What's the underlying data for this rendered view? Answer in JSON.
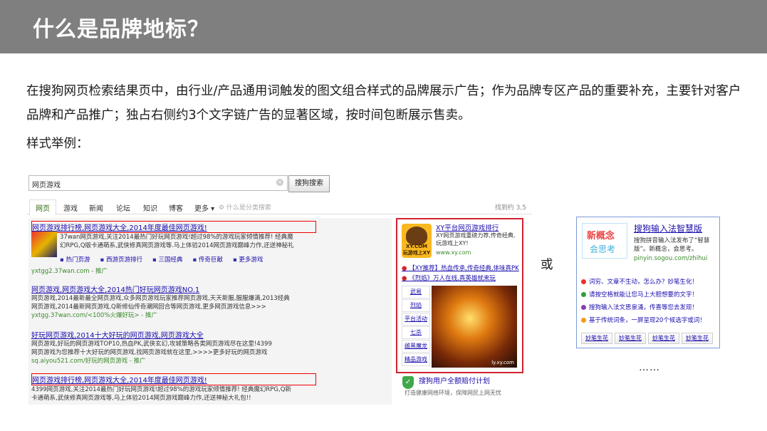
{
  "slide": {
    "title": "什么是品牌地标？",
    "description": "在搜狗网页检索结果页中，由行业/产品通用词触发的图文组合样式的品牌展示广告；作为品牌专区产品的重要补充，主要针对客户品牌和产品推广；独占右侧约3个文字链广告的显著区域，按时间包断展示售卖。",
    "example_label": "样式举例：",
    "or_label": "或",
    "ellipsis": "……"
  },
  "serp": {
    "query": "网页游戏",
    "search_button": "搜狗搜索",
    "clear_icon": "×",
    "tabs": [
      "网页",
      "游戏",
      "新闻",
      "论坛",
      "知识",
      "博客",
      "更多 ▾"
    ],
    "hint": "⚙ 什么是分类搜索",
    "result_count": "找到约 3,5",
    "results": [
      {
        "title": "网页游戏排行榜,网页游戏大全,2014年度最佳网页游戏!",
        "desc1": "37wan网页游戏,关注2014最热门好玩网页游戏!超过98%的游戏玩家倾情推荐! 经典魔",
        "desc2": "幻RPG,Q版卡通萌系,武侠修真网页游戏等.马上体验2014网页游戏巅峰力作,还送神秘礼",
        "sublinks": [
          "热门页游",
          "西游页游排行",
          "三国经典",
          "传奇巨献",
          "更多游戏"
        ],
        "url": "yxtgg2.37wan.com - 推广"
      },
      {
        "title": "网页游戏,网页游戏大全,2014热门好玩网页游戏NO.1",
        "desc1": "网页游戏,2014最新最全网页游戏,众多网页游戏玩家推荐网页游戏,天天新服,服服爆满,2013经典",
        "desc2": "网页游戏,2014最新网页游戏,Q新修仙传奇潮网回合等网页游戏,更多网页游戏信息>>>",
        "url": "yxtgg.37wan.com/<100%火爆好玩> - 推广"
      },
      {
        "title": "好玩网页游戏,2014十大好玩的网页游戏,网页游戏大全",
        "desc1": "网页游戏,好玩的网页游戏TOP10,热血PK,武侠玄幻,攻城策略各类网页游戏尽在这里!4399",
        "desc2": "网页游戏为您推荐十大好玩的网页游戏,找网页游戏就在这里,>>>>更多好玩的网页游戏",
        "url": "sq.aiyou521.com/好玩的网页游戏 - 推广"
      },
      {
        "title": "网页游戏排行榜,网页游戏大全,2014年度最佳网页游戏!",
        "desc1": "4399网页游戏,关注2014最热门好玩网页游戏!超过98%的游戏玩家倾情推荐! 经典魔幻RPG,Q新",
        "desc2": "卡通萌系,武侠修真网页游戏等,马上体验2014网页游戏巅峰力作,还送神秘大礼包!!"
      }
    ],
    "brand_ad": {
      "logo_text": "XY.COM",
      "logo_sub": "玩游戏上XY",
      "title": "XY平台网页游戏排行",
      "desc": "XY网页游戏重磅力荐,传奇经典,玩游戏上XY!",
      "url": "www.xy.com",
      "links": [
        "【XY推荐】热血传承,传奇经典,体味真PK",
        "《烈焰》万人在线,真英雄就来玩"
      ],
      "side_links": [
        "武易",
        "烈焰",
        "平台活动",
        "七杀",
        "雌黑魔龙",
        "精品游戏"
      ],
      "art_watermark": "ly.xy.com"
    },
    "protect": {
      "title": "搜狗用户全额赔付计划",
      "sub": "打造健康网络环境，保障网民上网无忧",
      "shield_glyph": "✓"
    }
  },
  "alt_ad": {
    "logo_line1": "新概念",
    "logo_line2": "会思考",
    "title": "搜狗输入法智慧版",
    "desc": "搜狗拼音输入法发布了“智慧版”。新概念，会思考。",
    "url": "pinyin.sogou.com/zhihui",
    "bullets": [
      {
        "text": "词穷、文章不生动，怎么办？妙笔生化！",
        "color": "#e8322c"
      },
      {
        "text": "请按空格就能让您马上大胆想要的文字！",
        "color": "#2f9e3b"
      },
      {
        "text": "搜狗输入法文思泉涌，传喜等您去发现！",
        "color": "#8a3bb5"
      },
      {
        "text": "基于传统词条，一屏呈现20个候选字或词！",
        "color": "#f39a16"
      }
    ],
    "buttons": [
      "妙笔生花",
      "妙笔生花",
      "妙笔生花",
      "妙笔生花"
    ]
  }
}
